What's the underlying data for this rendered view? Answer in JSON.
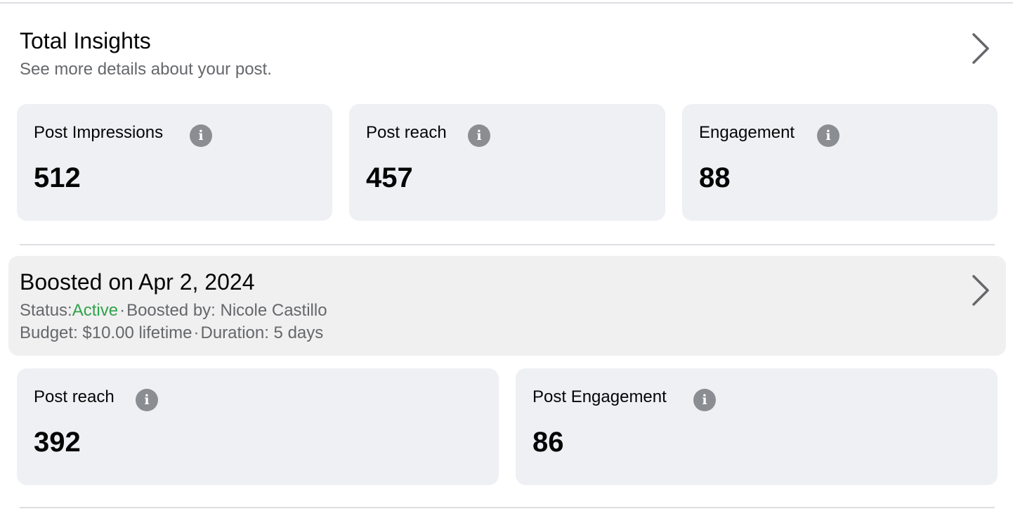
{
  "insights": {
    "title": "Total Insights",
    "subtitle": "See more details about your post.",
    "metrics": [
      {
        "label": "Post Impressions",
        "value": "512"
      },
      {
        "label": "Post reach",
        "value": "457"
      },
      {
        "label": "Engagement",
        "value": "88"
      }
    ]
  },
  "boost": {
    "title": "Boosted on Apr 2, 2024",
    "status_prefix": "Status:",
    "status_value": "Active",
    "separator": "·",
    "boosted_by": "Boosted by: Nicole Castillo",
    "budget": "Budget: $10.00 lifetime",
    "duration": "Duration: 5 days",
    "metrics": [
      {
        "label": "Post reach",
        "value": "392"
      },
      {
        "label": "Post Engagement",
        "value": "86"
      }
    ]
  },
  "colors": {
    "status_active": "#31a24c",
    "card_bg": "#eff0f4",
    "muted_text": "#65676b",
    "info_icon": "#8a8d91"
  },
  "icons": {
    "chevron": "chevron-right-icon",
    "info": "info-icon"
  }
}
